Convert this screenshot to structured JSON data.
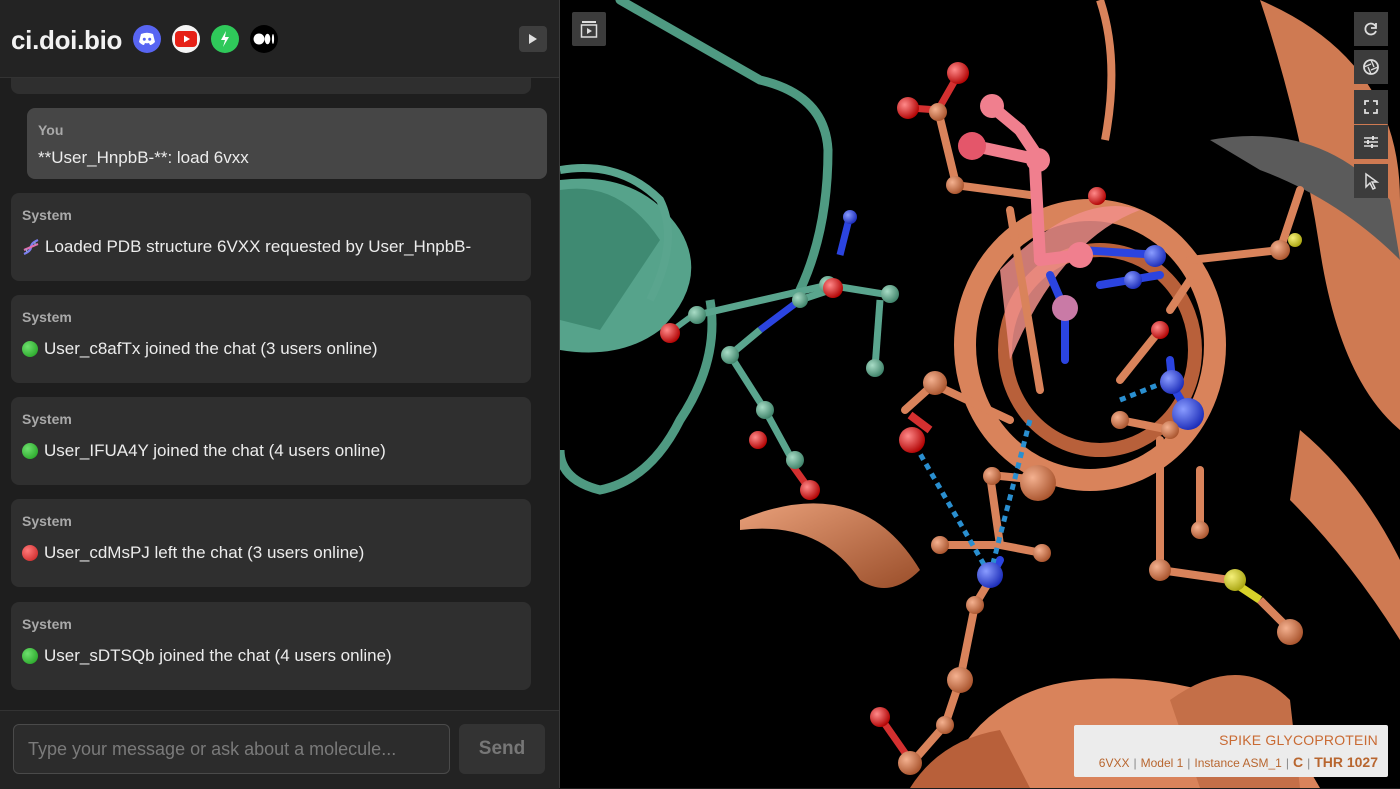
{
  "header": {
    "title": "ci.doi.bio",
    "social_icons": [
      "discord-icon",
      "youtube-icon",
      "strava-like-icon",
      "medium-icon"
    ]
  },
  "messages": [
    {
      "sender": "You",
      "text": "**User_HnpbB-**: load 6vxx",
      "kind": "you"
    },
    {
      "sender": "System",
      "icon": "dna-icon",
      "text": "Loaded PDB structure 6VXX requested by User_HnpbB-"
    },
    {
      "sender": "System",
      "icon": "green-dot",
      "text": "User_c8afTx joined the chat (3 users online)"
    },
    {
      "sender": "System",
      "icon": "green-dot",
      "text": "User_IFUA4Y joined the chat (4 users online)"
    },
    {
      "sender": "System",
      "icon": "red-dot",
      "text": "User_cdMsPJ left the chat (3 users online)"
    },
    {
      "sender": "System",
      "icon": "green-dot",
      "text": "User_sDTSQb joined the chat (4 users online)"
    }
  ],
  "input": {
    "placeholder": "Type your message or ask about a molecule...",
    "value": "",
    "send_label": "Send"
  },
  "viewer": {
    "entity_name": "SPIKE GLYCOPROTEIN",
    "pdb_id": "6VXX",
    "model": "Model 1",
    "instance": "Instance ASM_1",
    "chain": "C",
    "residue": "THR 1027",
    "colors": {
      "chain_a": "#5aa58e",
      "chain_c": "#d9835b",
      "highlight": "#f07f8e",
      "oxygen": "#e01818",
      "nitrogen": "#2b44e0",
      "sulfur": "#d7d22a",
      "hbond": "#2a8fd0"
    }
  }
}
